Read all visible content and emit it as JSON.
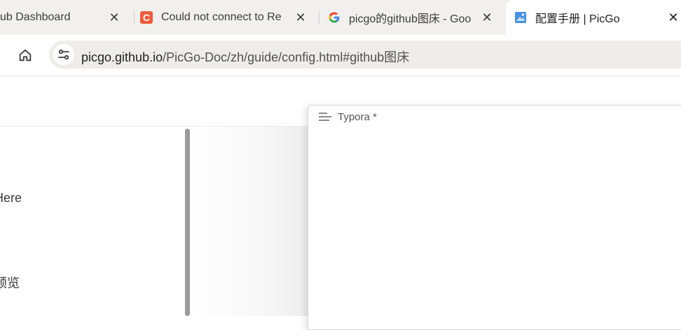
{
  "tabs": [
    {
      "label": "ub Dashboard",
      "close": "✕",
      "icon": "none"
    },
    {
      "label": "Could not connect to Re",
      "close": "✕",
      "icon": "c-logo-icon"
    },
    {
      "label": "picgo的github图床 - Goo",
      "close": "✕",
      "icon": "google-icon"
    },
    {
      "label": "配置手册 | PicGo",
      "close": "✕",
      "icon": "picgo-icon",
      "active": true
    }
  ],
  "tab_favicon_letter": "C",
  "toolbar": {
    "home_icon": "home-icon",
    "site_info_icon": "tune-icon",
    "url_host": "picgo.github.io",
    "url_path": "/PicGo-Doc/zh/guide/config.html#github图床"
  },
  "page": {
    "sidebar_text_1": "Here",
    "sidebar_text_2": "预览"
  },
  "typora": {
    "title": "Typora *",
    "menu_icon": "outline-menu-icon"
  },
  "colors": {
    "tabstrip": "#f1f0ef",
    "omnibox": "#efedec",
    "c_logo": "#f05a3a"
  }
}
